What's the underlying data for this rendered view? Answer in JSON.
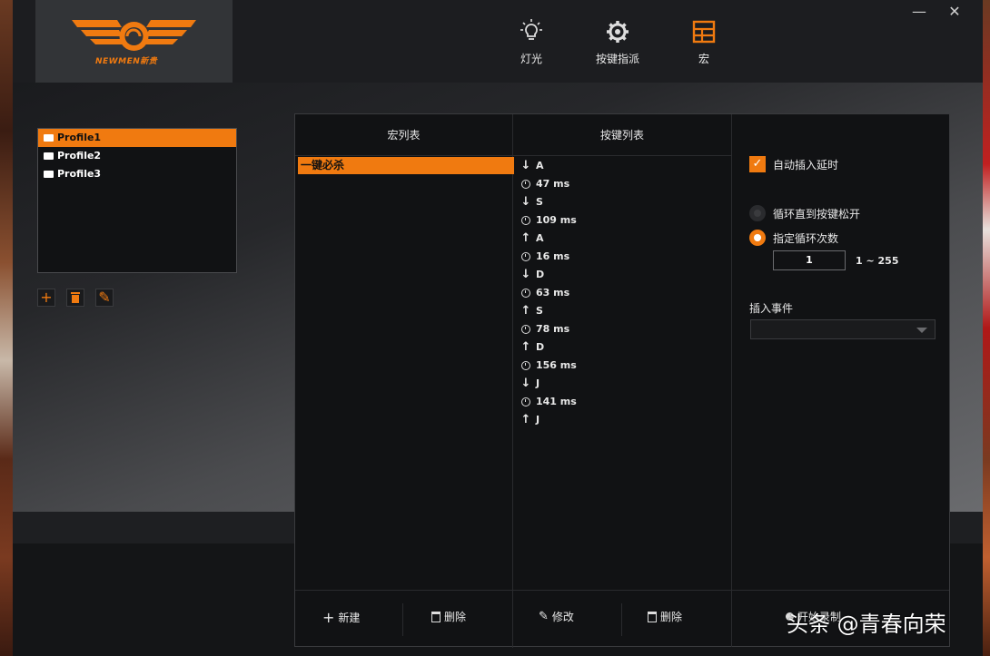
{
  "brand": {
    "logo_text": "NEWMEN新贵"
  },
  "nav": [
    {
      "label": "灯光",
      "icon": "bulb-icon"
    },
    {
      "label": "按键指派",
      "icon": "gear-icon"
    },
    {
      "label": "宏",
      "icon": "grid-icon"
    }
  ],
  "window": {
    "minimize": "—",
    "close": "✕"
  },
  "profiles": [
    "Profile1",
    "Profile2",
    "Profile3"
  ],
  "tools": {
    "add": "+",
    "edit": "✎"
  },
  "macro_list": {
    "header": "宏列表",
    "items": [
      "一键必杀"
    ]
  },
  "key_list": {
    "header": "按键列表",
    "items": [
      {
        "type": "down",
        "text": "A"
      },
      {
        "type": "delay",
        "text": "47 ms"
      },
      {
        "type": "down",
        "text": "S"
      },
      {
        "type": "delay",
        "text": "109 ms"
      },
      {
        "type": "up",
        "text": "A"
      },
      {
        "type": "delay",
        "text": "16 ms"
      },
      {
        "type": "down",
        "text": "D"
      },
      {
        "type": "delay",
        "text": "63 ms"
      },
      {
        "type": "up",
        "text": "S"
      },
      {
        "type": "delay",
        "text": "78 ms"
      },
      {
        "type": "up",
        "text": "D"
      },
      {
        "type": "delay",
        "text": "156 ms"
      },
      {
        "type": "down",
        "text": "J"
      },
      {
        "type": "delay",
        "text": "141 ms"
      },
      {
        "type": "up",
        "text": "J"
      }
    ]
  },
  "options": {
    "auto_delay": "自动插入延时",
    "loop_until_release": "循环直到按键松开",
    "loop_count": "指定循环次数",
    "loop_value": "1",
    "loop_range": "1 ~ 255",
    "insert_event": "插入事件"
  },
  "footer": {
    "new": "新建",
    "delete1": "删除",
    "modify": "修改",
    "delete2": "删除",
    "record": "开始录制"
  },
  "watermark": "头条 @青春向荣"
}
